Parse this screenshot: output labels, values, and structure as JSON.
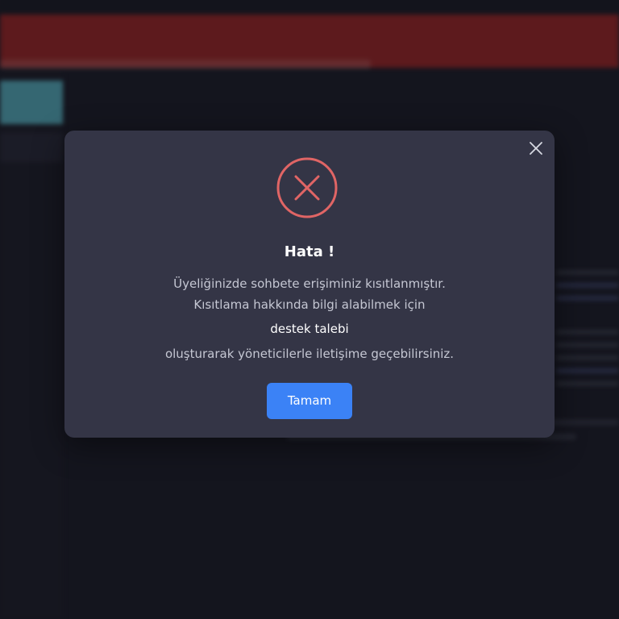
{
  "dialog": {
    "title": "Hata !",
    "message_line1": "Üyeliğinizde sohbete erişiminiz kısıtlanmıştır.",
    "message_line2": "Kısıtlama hakkında bilgi alabilmek için",
    "support_link": "destek talebi",
    "message_line3": "oluşturarak yöneticilerle iletişime geçebilirsiniz.",
    "confirm_label": "Tamam",
    "icon": "error-x-circle-icon",
    "close_icon": "close-icon"
  },
  "colors": {
    "modal_bg": "#343546",
    "accent": "#3b82f6",
    "error": "#e06565",
    "banner": "#8a2424"
  }
}
